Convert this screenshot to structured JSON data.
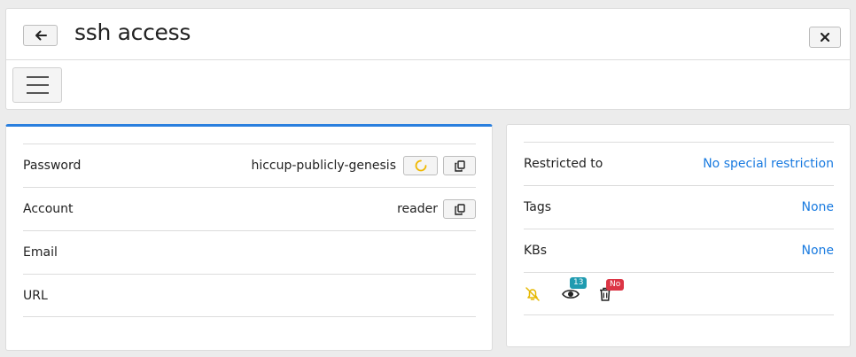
{
  "header": {
    "title": "ssh access"
  },
  "details": {
    "rows": [
      {
        "label": "Password",
        "value": "hiccup-publicly-genesis"
      },
      {
        "label": "Account",
        "value": "reader"
      },
      {
        "label": "Email",
        "value": ""
      },
      {
        "label": "URL",
        "value": ""
      }
    ]
  },
  "meta": {
    "rows": [
      {
        "label": "Restricted to",
        "value": "No special restriction"
      },
      {
        "label": "Tags",
        "value": "None"
      },
      {
        "label": "KBs",
        "value": "None"
      }
    ],
    "watchers_count": "13",
    "delete_badge": "No"
  },
  "colors": {
    "accent": "#2a7fde",
    "link": "#1a7be0",
    "bell": "#e6b800",
    "count_badge": "#1f9bb0",
    "delete_badge": "#dc3545"
  }
}
